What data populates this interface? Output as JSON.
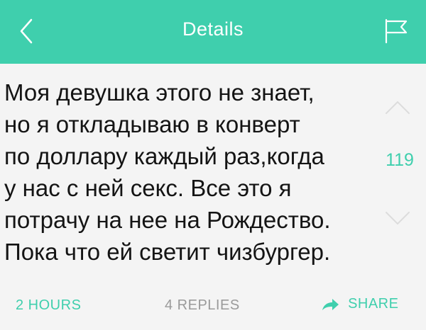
{
  "header": {
    "title": "Details",
    "back_icon": "chevron-left-icon",
    "flag_icon": "flag-icon"
  },
  "post": {
    "text": "Моя девушка этого не знает,\nно я откладываю в конверт\nпо доллару каждый раз,когда\nу нас с ней секс. Все это я\nпотрачу на нее на Рождество.\nПока что ей светит чизбургер.",
    "score": "119"
  },
  "footer": {
    "time": "2 HOURS",
    "replies": "4 REPLIES",
    "share_label": "SHARE",
    "share_icon": "share-arrow-icon"
  },
  "colors": {
    "accent": "#3fcfad",
    "header_bg": "#3fcfad",
    "card_bg": "#f4f4f4",
    "text": "#141414"
  }
}
